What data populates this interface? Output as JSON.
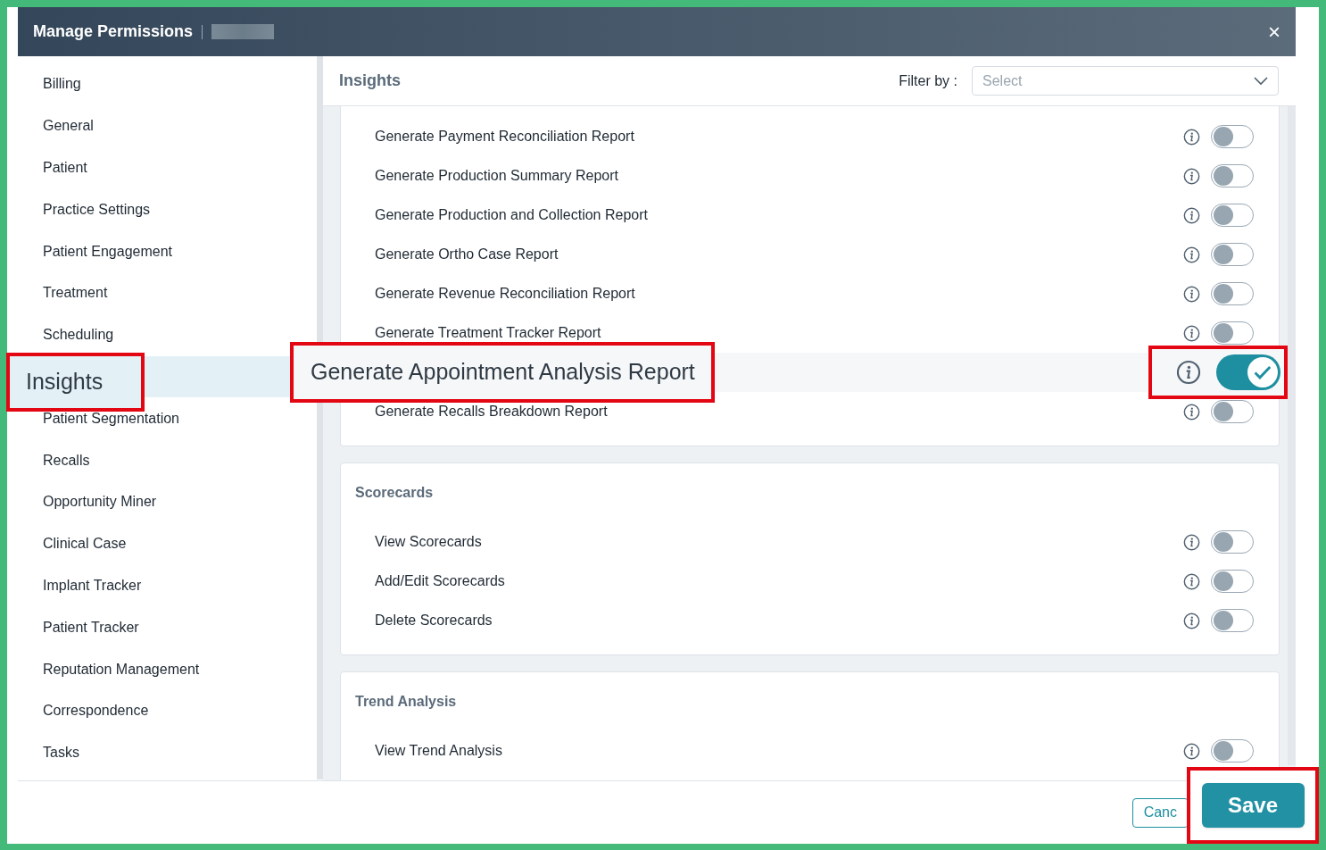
{
  "window": {
    "title": "Manage Permissions",
    "close": "×"
  },
  "sidebar": {
    "items": [
      {
        "label": "Billing",
        "selected": false,
        "callout": false
      },
      {
        "label": "General",
        "selected": false,
        "callout": false
      },
      {
        "label": "Patient",
        "selected": false,
        "callout": false
      },
      {
        "label": "Practice Settings",
        "selected": false,
        "callout": false
      },
      {
        "label": "Patient Engagement",
        "selected": false,
        "callout": false
      },
      {
        "label": "Treatment",
        "selected": false,
        "callout": false
      },
      {
        "label": "Scheduling",
        "selected": false,
        "callout": false
      },
      {
        "label": "Insights",
        "selected": true,
        "callout": true
      },
      {
        "label": "Patient Segmentation",
        "selected": false,
        "callout": false
      },
      {
        "label": "Recalls",
        "selected": false,
        "callout": false
      },
      {
        "label": "Opportunity Miner",
        "selected": false,
        "callout": false
      },
      {
        "label": "Clinical Case",
        "selected": false,
        "callout": false
      },
      {
        "label": "Implant Tracker",
        "selected": false,
        "callout": false
      },
      {
        "label": "Patient Tracker",
        "selected": false,
        "callout": false
      },
      {
        "label": "Reputation Management",
        "selected": false,
        "callout": false
      },
      {
        "label": "Correspondence",
        "selected": false,
        "callout": false
      },
      {
        "label": "Tasks",
        "selected": false,
        "callout": false
      }
    ]
  },
  "panel": {
    "title": "Insights",
    "filter": {
      "label": "Filter by :",
      "placeholder": "Select"
    }
  },
  "sections": [
    {
      "rows": [
        {
          "label": "Generate Payment Reconciliation Report",
          "on": false,
          "callout": false
        },
        {
          "label": "Generate Production Summary Report",
          "on": false,
          "callout": false
        },
        {
          "label": "Generate Production and Collection Report",
          "on": false,
          "callout": false
        },
        {
          "label": "Generate Ortho Case Report",
          "on": false,
          "callout": false
        },
        {
          "label": "Generate Revenue Reconciliation Report",
          "on": false,
          "callout": false
        },
        {
          "label": "Generate Treatment Tracker Report",
          "on": false,
          "callout": false
        },
        {
          "label": "Generate Appointment Analysis Report",
          "on": true,
          "callout": true
        },
        {
          "label": "Generate Recalls Breakdown Report",
          "on": false,
          "callout": false
        }
      ]
    },
    {
      "title": "Scorecards",
      "rows": [
        {
          "label": "View Scorecards",
          "on": false,
          "callout": false
        },
        {
          "label": "Add/Edit Scorecards",
          "on": false,
          "callout": false
        },
        {
          "label": "Delete Scorecards",
          "on": false,
          "callout": false
        }
      ]
    },
    {
      "title": "Trend Analysis",
      "rows": [
        {
          "label": "View Trend Analysis",
          "on": false,
          "callout": false
        }
      ]
    }
  ],
  "footer": {
    "cancel": {
      "label": "Canc"
    },
    "save": {
      "label": "Save",
      "callout": true
    }
  }
}
